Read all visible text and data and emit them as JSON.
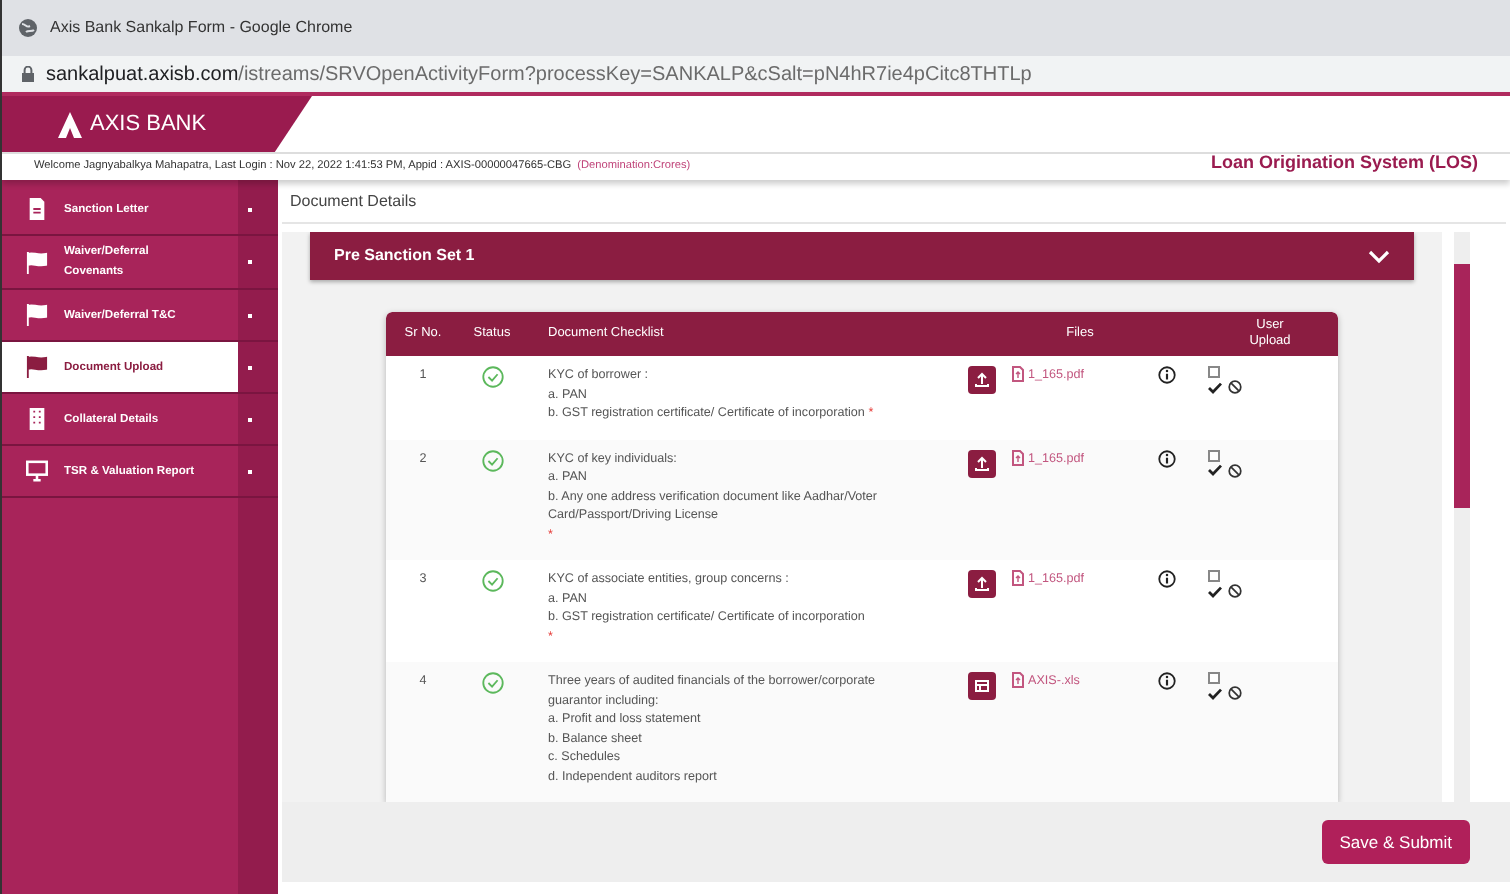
{
  "window": {
    "title": "Axis Bank Sankalp Form - Google Chrome"
  },
  "address": {
    "host": "sankalpuat.axisb.com",
    "path": "/istreams/SRVOpenActivityForm?processKey=SANKALP&cSalt=pN4hR7ie4pCitc8THTLp"
  },
  "header": {
    "brand": "AXIS BANK",
    "welcome": "Welcome Jagnyabalkya Mahapatra, Last Login : Nov 22, 2022 1:41:53 PM, Appid : AXIS-00000047665-CBG",
    "denomination": "(Denomination:Crores)",
    "system": "Loan Origination System (LOS)"
  },
  "sidebar": {
    "items": [
      {
        "label": "Sanction Letter",
        "kind": "file",
        "selected": false
      },
      {
        "label": "Waiver/Deferral Covenants",
        "kind": "flag",
        "selected": false
      },
      {
        "label": "Waiver/Deferral T&C",
        "kind": "flag",
        "selected": false
      },
      {
        "label": "Document Upload",
        "kind": "flag",
        "selected": true
      },
      {
        "label": "Collateral Details",
        "kind": "building",
        "selected": false
      },
      {
        "label": "TSR & Valuation Report",
        "kind": "monitor",
        "selected": false
      }
    ]
  },
  "page_title": "Document Details",
  "section": {
    "title": "Pre Sanction Set 1",
    "expanded": true
  },
  "table": {
    "columns": [
      "Sr No.",
      "Status",
      "Document Checklist",
      "Files",
      "User Upload"
    ],
    "rows": [
      {
        "sr": "1",
        "done": true,
        "lines": [
          "KYC of borrower :",
          "a. PAN",
          "b. GST registration certificate/ Certificate of incorporation"
        ],
        "inline_mark": "*",
        "kind": "upload",
        "file": "1_165.pdf",
        "checked": false
      },
      {
        "sr": "2",
        "done": true,
        "lines": [
          "KYC of key individuals:",
          "a. PAN",
          "b. Any one address verification document like Aadhar/Voter Card/Passport/Driving License"
        ],
        "required_mark": "*",
        "kind": "upload",
        "file": "1_165.pdf",
        "checked": false
      },
      {
        "sr": "3",
        "done": true,
        "lines": [
          "KYC of associate entities, group concerns :",
          "a. PAN",
          "b. GST registration certificate/ Certificate of incorporation"
        ],
        "required_mark": "*",
        "kind": "upload",
        "file": "1_165.pdf",
        "checked": false
      },
      {
        "sr": "4",
        "done": true,
        "lines": [
          "Three years of audited financials of the borrower/corporate guarantor including:",
          "a. Profit and loss statement",
          "b. Balance sheet",
          "c. Schedules",
          "d. Independent auditors report"
        ],
        "kind": "sheet",
        "file": "AXIS-.xls",
        "checked": false
      }
    ]
  },
  "footer": {
    "submit": "Save & Submit"
  }
}
